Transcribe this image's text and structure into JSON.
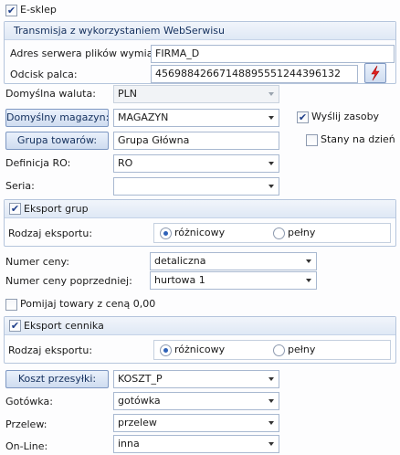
{
  "eshop": {
    "checkbox_label": "E-sklep",
    "checked": true
  },
  "transmission": {
    "title": "Transmisja z wykorzystaniem WebSerwisu",
    "server_label": "Adres serwera plików wymiany:",
    "server_value": "FIRMA_D",
    "fingerprint_label": "Odcisk palca:",
    "fingerprint_value": "4569884266714889555124439613 2",
    "bolt_icon": "lightning-icon"
  },
  "currency": {
    "label": "Domyślna waluta:",
    "value": "PLN"
  },
  "warehouse": {
    "button_label": "Domyślny magazyn:",
    "value": "MAGAZYN"
  },
  "send_resources": {
    "label": "Wyślij zasoby",
    "checked": true
  },
  "product_group": {
    "button_label": "Grupa towarów:",
    "value": "Grupa Główna"
  },
  "stock_on_day": {
    "label": "Stany na dzień",
    "checked": false
  },
  "ro_definition": {
    "label": "Definicja RO:",
    "value": "RO"
  },
  "series": {
    "label": "Seria:",
    "value": ""
  },
  "export_groups": {
    "checkbox_label": "Eksport grup",
    "checked": true,
    "type_label": "Rodzaj eksportu:",
    "option_incremental": "różnicowy",
    "option_full": "pełny",
    "selected": "różnicowy"
  },
  "price_number": {
    "label": "Numer ceny:",
    "value": "detaliczna"
  },
  "previous_price_number": {
    "label": "Numer ceny poprzedniej:",
    "value": "hurtowa 1"
  },
  "skip_zero_price": {
    "label": "Pomijaj towary z ceną 0,00",
    "checked": false
  },
  "export_pricelist": {
    "checkbox_label": "Eksport cennika",
    "checked": true,
    "type_label": "Rodzaj eksportu:",
    "option_incremental": "różnicowy",
    "option_full": "pełny",
    "selected": "różnicowy"
  },
  "shipping_cost": {
    "button_label": "Koszt przesyłki:",
    "value": "KOSZT_P"
  },
  "cash": {
    "label": "Gotówka:",
    "value": "gotówka"
  },
  "transfer": {
    "label": "Przelew:",
    "value": "przelew"
  },
  "online": {
    "label": "On-Line:",
    "value": "inna"
  },
  "colors": {
    "accent": "#2f62b8",
    "button": "#cfdcf0",
    "border": "#a8b8d0",
    "bolt": "#e02020"
  }
}
